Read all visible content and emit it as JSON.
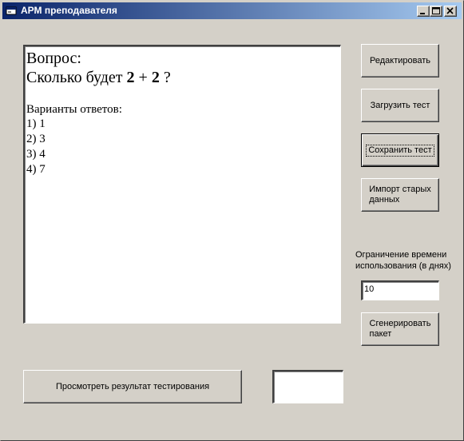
{
  "window": {
    "title": "АРМ преподавателя",
    "caption_buttons": {
      "minimize": "minimize-icon",
      "maximize": "maximize-icon",
      "close": "close-icon"
    }
  },
  "editor": {
    "question_label": "Вопрос:",
    "question_prefix": "Сколько будет ",
    "operand_a": "2",
    "operator": " + ",
    "operand_b": "2",
    "question_suffix": " ?",
    "answers_label": "Варианты ответов:",
    "answers": [
      "1) 1",
      "2) 3",
      "3) 4",
      "4) 7"
    ]
  },
  "buttons": {
    "edit": "Редактировать",
    "load_test": "Загрузить тест",
    "save_test": "Сохранить тест",
    "import_line1": "Импорт старых",
    "import_line2": "данных",
    "generate_line1": "Сгенерировать",
    "generate_line2": "пакет",
    "view_results": "Просмотреть результат тестирования"
  },
  "time_limit": {
    "label_line1": "Ограничение времени",
    "label_line2": "использования (в днях)",
    "value": "10"
  },
  "result_box": {
    "value": ""
  },
  "colors": {
    "face": "#d4d0c8",
    "title_start": "#0a246a",
    "title_end": "#a6caf0"
  }
}
